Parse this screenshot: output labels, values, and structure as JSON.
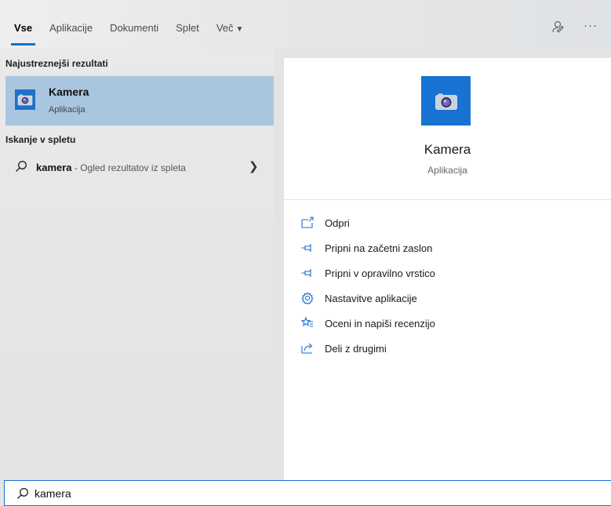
{
  "tabs": [
    {
      "label": "Vse",
      "active": true
    },
    {
      "label": "Aplikacije"
    },
    {
      "label": "Dokumenti"
    },
    {
      "label": "Splet"
    },
    {
      "label": "Več"
    }
  ],
  "left": {
    "best_header": "Najustreznejši rezultati",
    "best_match": {
      "title": "Kamera",
      "subtitle": "Aplikacija",
      "icon": "camera-icon"
    },
    "web_header": "Iskanje v spletu",
    "web_query": "kamera",
    "web_suffix": " - Ogled rezultatov iz spleta"
  },
  "preview": {
    "title": "Kamera",
    "subtitle": "Aplikacija",
    "actions": [
      {
        "label": "Odpri",
        "icon": "open-icon"
      },
      {
        "label": "Pripni na začetni zaslon",
        "icon": "pin-icon"
      },
      {
        "label": "Pripni v opravilno vrstico",
        "icon": "pin-icon"
      },
      {
        "label": "Nastavitve aplikacije",
        "icon": "gear-icon"
      },
      {
        "label": "Oceni in napiši recenzijo",
        "icon": "rate-review-icon"
      },
      {
        "label": "Deli z drugimi",
        "icon": "share-icon"
      }
    ]
  },
  "search": {
    "value": "kamera"
  },
  "colors": {
    "accent": "#0a74d6",
    "selection": "#a9c6e0",
    "app_tile": "#1873d3"
  }
}
